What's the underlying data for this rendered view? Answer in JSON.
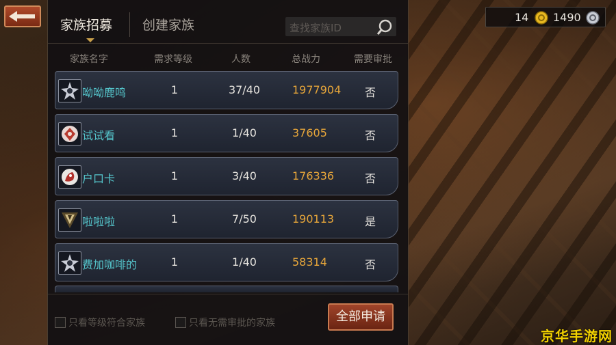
{
  "tabs": {
    "active": "家族招募",
    "inactive": "创建家族"
  },
  "search": {
    "placeholder": "查找家族ID"
  },
  "columns": [
    "家族名字",
    "需求等级",
    "人数",
    "总战力",
    "需要审批"
  ],
  "rows": [
    {
      "name": "呦呦鹿鸣",
      "level": "1",
      "members": "37/40",
      "power": "1977904",
      "approval": "否",
      "emblem": "star-crest-icon"
    },
    {
      "name": "试试看",
      "level": "1",
      "members": "1/40",
      "power": "37605",
      "approval": "否",
      "emblem": "fan-crest-icon"
    },
    {
      "name": "户口卡",
      "level": "1",
      "members": "3/40",
      "power": "176336",
      "approval": "否",
      "emblem": "beast-crest-icon"
    },
    {
      "name": "啦啦啦",
      "level": "1",
      "members": "7/50",
      "power": "190113",
      "approval": "是",
      "emblem": "v-crest-icon"
    },
    {
      "name": "费加咖啡的",
      "level": "1",
      "members": "1/40",
      "power": "58314",
      "approval": "否",
      "emblem": "star-crest-icon"
    }
  ],
  "filters": [
    "只看等级符合家族",
    "只看无需审批的家族"
  ],
  "apply_all": "全部申请",
  "currency": {
    "gold": "14",
    "silver": "1490"
  },
  "watermark": "京华手游网",
  "colors": {
    "name": "#55c6cc",
    "power": "#e7a63a",
    "button": "#a0442a",
    "watermark": "#f2d100"
  }
}
